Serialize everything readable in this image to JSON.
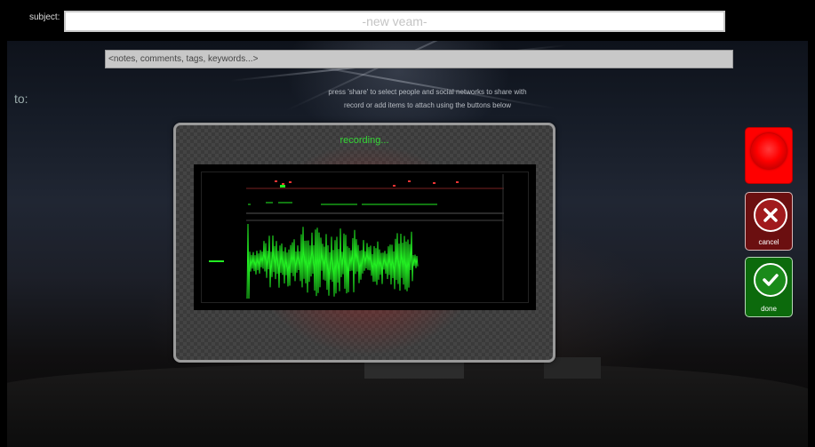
{
  "header": {
    "subject_label": "subject:",
    "subject_placeholder": "-new veam-"
  },
  "notes": {
    "placeholder": "<notes, comments, tags, keywords...>"
  },
  "to_label": "to:",
  "instructions": {
    "line1": "press 'share' to select people and social networks to share with",
    "line2": "record or add items to attach using the buttons below"
  },
  "recorder": {
    "status": "recording...",
    "waveform_color": "#22ee22"
  },
  "actions": {
    "record_icon": "record-icon",
    "cancel_label": "cancel",
    "cancel_icon": "x-icon",
    "done_label": "done",
    "done_icon": "check-icon"
  },
  "colors": {
    "record": "#ff0000",
    "cancel": "#6b0f10",
    "done": "#0c6a0c",
    "status_text": "#35d635"
  }
}
